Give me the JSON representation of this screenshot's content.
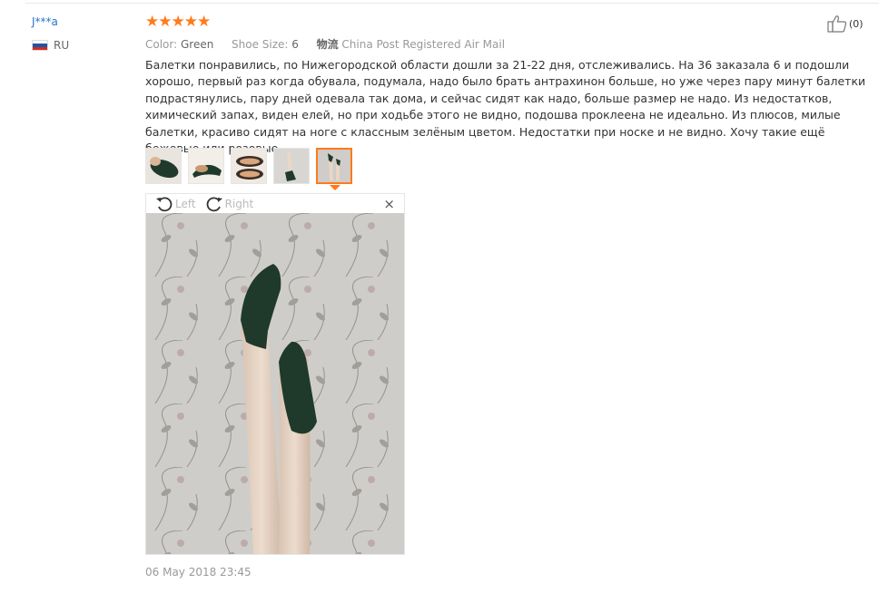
{
  "user": {
    "name": "J***a",
    "country": "RU",
    "flag": [
      "#ffffff",
      "#1c57a7",
      "#d52b1e"
    ]
  },
  "rating": {
    "stars": "★★★★★",
    "count": 5
  },
  "meta": {
    "color_label": "Color:",
    "color_value": "Green",
    "size_label": "Shoe Size:",
    "size_value": "6",
    "shipping_label": "物流",
    "shipping_value": "China Post Registered Air Mail"
  },
  "like": {
    "count": "(0)"
  },
  "review": {
    "text": "Балетки понравились, по Нижегородской области дошли за 21-22 дня, отслеживались. На 36 заказала 6 и подошли хорошо, первый раз когда обувала, подумала, надо было брать антрахинон больше, но уже через пару минут балетки подрастянулись, пару дней одевала так дома, и сейчас сидят как надо, больше размер не надо. Из недостатков, химический запах, виден елей, но при ходьбе этого не видно, подошва проклеена не идеально. Из плюсов, милые балетки, красиво сидят на ноге с классным зелёным цветом. Недостатки при носке и не видно. Хочу такие ещё бежевые или розовые."
  },
  "thumbnails": {
    "count": 5,
    "active_index": 4
  },
  "viewer": {
    "rotate_left": "Left",
    "rotate_right": "Right",
    "close": "×"
  },
  "date": "06 May 2018 23:45",
  "colors": {
    "accent": "#ff7a1a",
    "link": "#2a73c9",
    "shoe": "#1f3a2a"
  }
}
